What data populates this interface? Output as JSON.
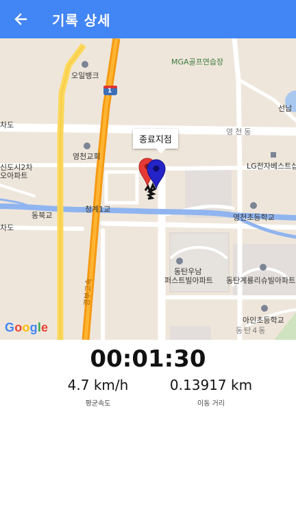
{
  "appbar": {
    "title": "기록 상세",
    "back_icon": "arrow-back-icon",
    "color": "#4285f4"
  },
  "map": {
    "labels": {
      "mga": "MGA골프연습장",
      "ouilbank": "오일뱅크",
      "seondong": "선납",
      "chado1": "차도",
      "yeongcheondong": "영천동",
      "church": "영천교회",
      "lg": "LG전자베스트샵",
      "sindosi": "신도시2차",
      "oapt": "오아파트",
      "cheonggye": "청계1교",
      "dongbukgyo": "동북교",
      "school": "영천초등학교",
      "chado2": "차도",
      "dongtan_apt1": "동탄우남",
      "dongtan_apt2": "퍼스트빌아파트",
      "gyeryong": "동탄계룡리슈빌아파트",
      "ain_school": "아인초등학교",
      "dongtan4": "동탄4동",
      "expressway": "경부고속",
      "route_no": "1"
    },
    "callout": "종료지점",
    "google": [
      "G",
      "o",
      "o",
      "g",
      "l",
      "e"
    ],
    "google_colors": [
      "#4285f4",
      "#ea4335",
      "#fbbc05",
      "#4285f4",
      "#34a853",
      "#ea4335"
    ],
    "start_marker_color": "#e53935",
    "end_marker_color": "#2323c8"
  },
  "stats": {
    "elapsed": "00:01:30",
    "speed_value": "4.7 km/h",
    "speed_label": "평균속도",
    "distance_value": "0.13917 km",
    "distance_label": "이동 거리"
  }
}
